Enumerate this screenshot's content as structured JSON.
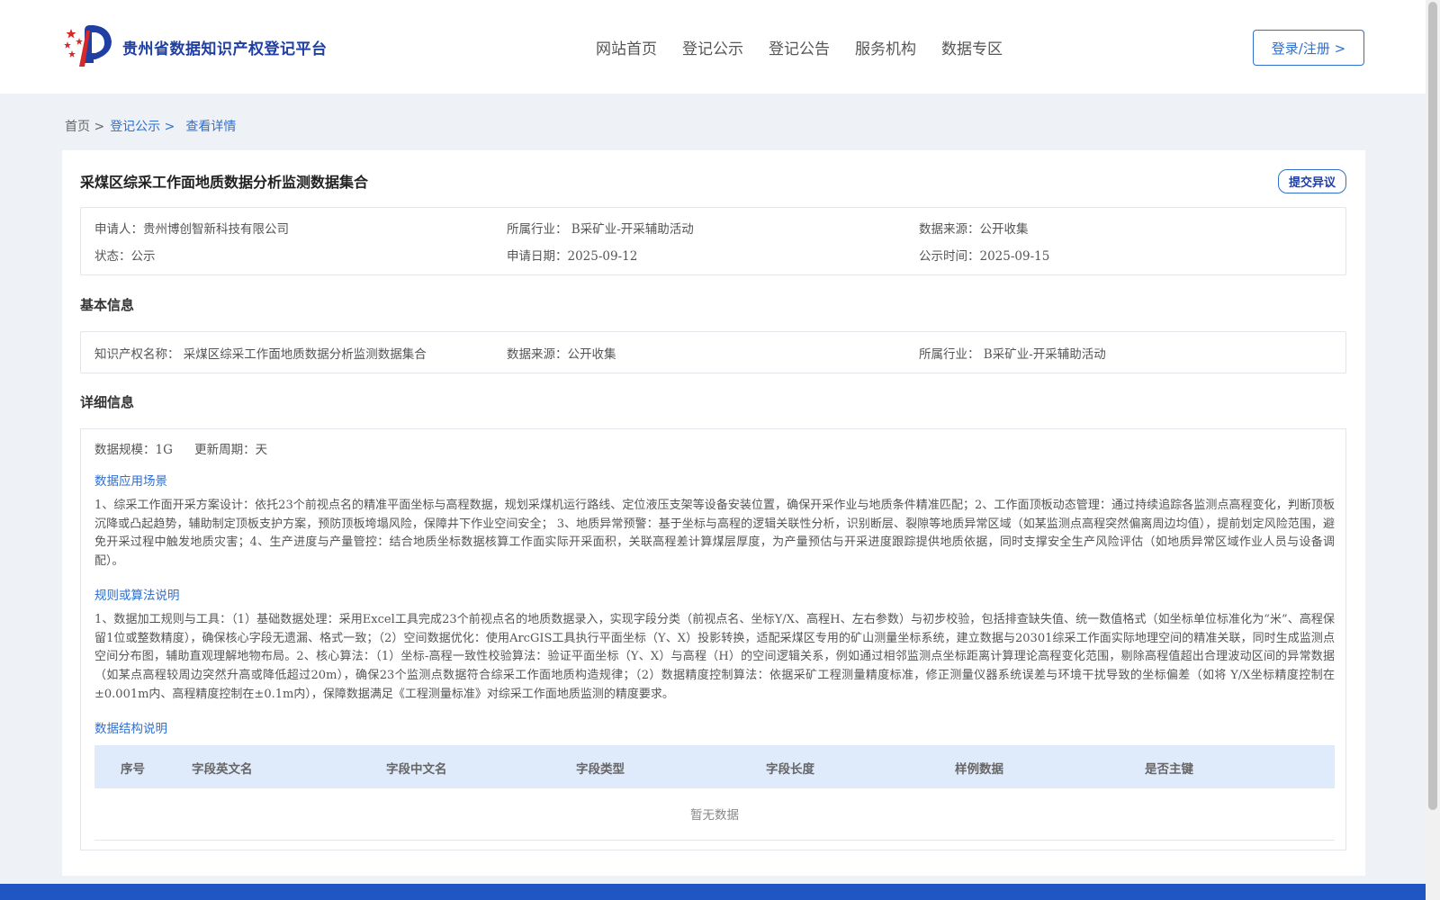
{
  "header": {
    "logo_text": "贵州省数据知识产权登记平台",
    "nav": [
      "网站首页",
      "登记公示",
      "登记公告",
      "服务机构",
      "数据专区"
    ],
    "login_label": "登录/注册 >"
  },
  "breadcrumb": {
    "home": "首页 >",
    "list": "登记公示 >",
    "current": "查看详情"
  },
  "record": {
    "title": "采煤区综采工作面地质数据分析监测数据集合",
    "objection_label": "提交异议",
    "summary": {
      "applicant": "申请人：贵州博创智新科技有限公司",
      "industry": "所属行业： B采矿业-开采辅助活动",
      "source": "数据来源：公开收集",
      "status": "状态：公示",
      "apply_date": "申请日期：2025-09-12",
      "publish_date": "公示时间：2025-09-15"
    }
  },
  "basic": {
    "section_title": "基本信息",
    "ip_name": "知识产权名称： 采煤区综采工作面地质数据分析监测数据集合",
    "source": "数据来源：公开收集",
    "industry": "所属行业： B采矿业-开采辅助活动"
  },
  "detail": {
    "section_title": "详细信息",
    "scale": "数据规模：1G",
    "update_cycle": "更新周期：天",
    "scenario_title": "数据应用场景",
    "scenario_text": "1、综采工作面开采方案设计：依托23个前视点名的精准平面坐标与高程数据，规划采煤机运行路线、定位液压支架等设备安装位置，确保开采作业与地质条件精准匹配；2、工作面顶板动态管理：通过持续追踪各监测点高程变化，判断顶板沉降或凸起趋势，辅助制定顶板支护方案，预防顶板垮塌风险，保障井下作业空间安全； 3、地质异常预警：基于坐标与高程的逻辑关联性分析，识别断层、裂隙等地质异常区域（如某监测点高程突然偏离周边均值），提前划定风险范围，避免开采过程中触发地质灾害；4、生产进度与产量管控：结合地质坐标数据核算工作面实际开采面积，关联高程差计算煤层厚度，为产量预估与开采进度跟踪提供地质依据，同时支撑安全生产风险评估（如地质异常区域作业人员与设备调配）。",
    "algorithm_title": "规则或算法说明",
    "algorithm_text": "1、数据加工规则与工具：（1）基础数据处理：采用Excel工具完成23个前视点名的地质数据录入，实现字段分类（前视点名、坐标Y/X、高程H、左右参数）与初步校验，包括排查缺失值、统一数值格式（如坐标单位标准化为“米”、高程保留1位或整数精度），确保核心字段无遗漏、格式一致；（2）空间数据优化：使用ArcGIS工具执行平面坐标（Y、X）投影转换，适配采煤区专用的矿山测量坐标系统，建立数据与20301综采工作面实际地理空间的精准关联，同时生成监测点空间分布图，辅助直观理解地物布局。2、核心算法：（1）坐标-高程一致性校验算法：验证平面坐标（Y、X）与高程（H）的空间逻辑关系，例如通过相邻监测点坐标距离计算理论高程变化范围，剔除高程值超出合理波动区间的异常数据（如某点高程较周边突然升高或降低超过20m），确保23个监测点数据符合综采工作面地质构造规律；（2）数据精度控制算法：依据采矿工程测量精度标准，修正测量仪器系统误差与环境干扰导致的坐标偏差（如将 Y/X坐标精度控制在±0.001m内、高程精度控制在±0.1m内），保障数据满足《工程测量标准》对综采工作面地质监测的精度要求。",
    "structure_title": "数据结构说明",
    "table_headers": [
      "序号",
      "字段英文名",
      "字段中文名",
      "字段类型",
      "字段长度",
      "样例数据",
      "是否主键"
    ],
    "empty_text": "暂无数据"
  },
  "colors": {
    "accent": "#2f6fd0",
    "brand_dark": "#1f3fa3",
    "table_header_bg": "#dfeafb",
    "footer_bg": "#1f56c3"
  }
}
